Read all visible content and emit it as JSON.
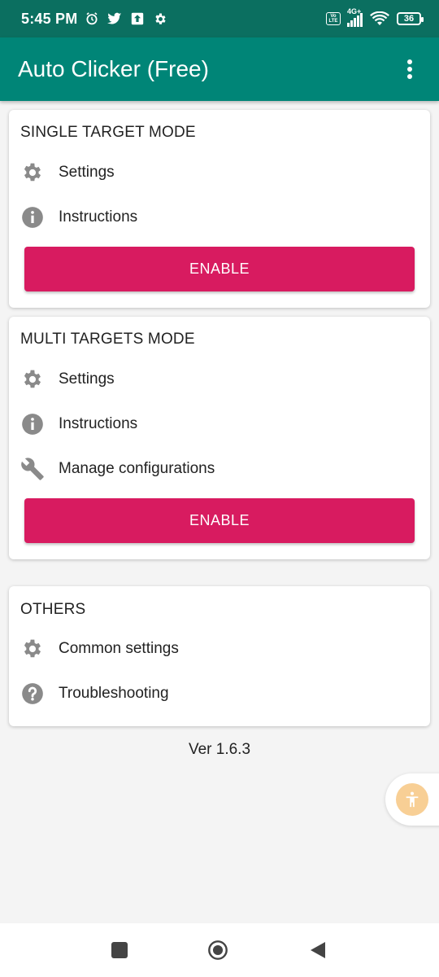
{
  "status_bar": {
    "time": "5:45 PM",
    "icons": [
      "alarm-icon",
      "twitter-icon",
      "upload-icon",
      "settings-icon"
    ],
    "network": "4G+",
    "volte": "Vo LTE",
    "battery": "36"
  },
  "app_bar": {
    "title": "Auto Clicker (Free)",
    "menu_icon": "more-vert-icon",
    "color": "#008577"
  },
  "single_target": {
    "title": "SINGLE TARGET MODE",
    "settings_label": "Settings",
    "instructions_label": "Instructions",
    "enable_label": "ENABLE"
  },
  "multi_target": {
    "title": "MULTI TARGETS MODE",
    "settings_label": "Settings",
    "instructions_label": "Instructions",
    "manage_label": "Manage configurations",
    "enable_label": "ENABLE"
  },
  "others": {
    "title": "OTHERS",
    "common_settings_label": "Common settings",
    "troubleshooting_label": "Troubleshooting"
  },
  "version": "Ver 1.6.3",
  "accent_color": "#d81b60"
}
